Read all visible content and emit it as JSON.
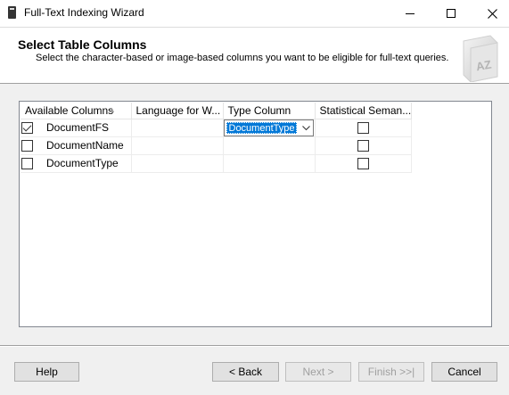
{
  "window": {
    "title": "Full-Text Indexing Wizard"
  },
  "header": {
    "title": "Select Table Columns",
    "subtitle": "Select the character-based or image-based columns you want to be eligible for full-text queries.",
    "art_text": "AZ"
  },
  "grid": {
    "columns": [
      "Available Columns",
      "Language for W...",
      "Type Column",
      "Statistical Seman..."
    ],
    "sort_indicator": "▲",
    "rows": [
      {
        "name": "DocumentFS",
        "selected": true,
        "language": "",
        "type_column": "DocumentType",
        "statistical": false
      },
      {
        "name": "DocumentName",
        "selected": false,
        "language": "",
        "type_column": "",
        "statistical": false
      },
      {
        "name": "DocumentType",
        "selected": false,
        "language": "",
        "type_column": "",
        "statistical": false
      }
    ]
  },
  "buttons": {
    "help": "Help",
    "back": "< Back",
    "next": "Next >",
    "finish": "Finish >>|",
    "cancel": "Cancel"
  },
  "colors": {
    "selection": "#0078d7",
    "disabled_text": "#a0a0a0"
  }
}
